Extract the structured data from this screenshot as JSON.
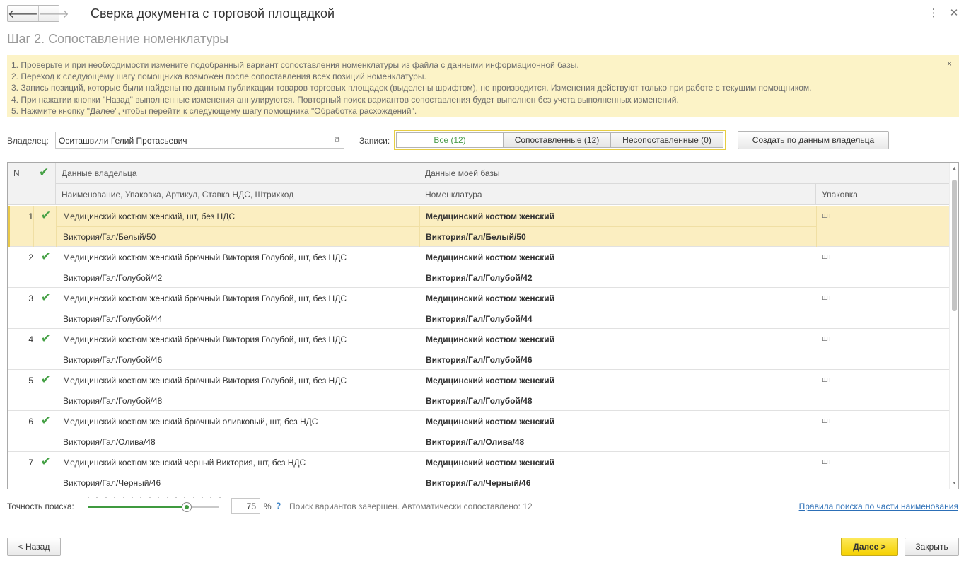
{
  "window": {
    "title": "Сверка документа с торговой площадкой",
    "back_icon": "arrow-left-icon",
    "forward_icon": "arrow-right-icon",
    "more_icon": "more-vertical-icon",
    "close_icon": "close-icon"
  },
  "step_title": "Шаг 2. Сопоставление номенклатуры",
  "info": {
    "lines": [
      "1. Проверьте и при необходимости измените подобранный вариант сопоставления номенклатуры из файла с данными информационной базы.",
      "2. Переход к следующему шагу помощника возможен после сопоставления всех позиций номенклатуры.",
      "3. Запись позиций, которые были найдены по данным публикации товаров торговых площадок (выделены шрифтом), не производится. Изменения действуют только при работе с текущим помощником.",
      "4. При нажатии кнопки \"Назад\" выполненные изменения аннулируются. Повторный поиск вариантов сопоставления будет выполнен без учета выполненных изменений.",
      "5. Нажмите кнопку \"Далее\", чтобы перейти к следующему шагу помощника \"Обработка расхождений\"."
    ],
    "close_glyph": "×"
  },
  "owner": {
    "label": "Владелец:",
    "value": "Оситашвили Гелий Протасьевич",
    "open_icon": "open-window-icon"
  },
  "records": {
    "label": "Записи:",
    "filters": [
      "Все (12)",
      "Сопоставленные (12)",
      "Несопоставленные (0)"
    ],
    "active_index": 0
  },
  "create_button": "Создать по данным владельца",
  "table": {
    "col_n": "N",
    "col_check_icon": "checkmark-icon",
    "group_owner": "Данные владельца",
    "group_base": "Данные моей базы",
    "sub_owner": "Наименование, Упаковка, Артикул, Ставка НДС, Штрихкод",
    "sub_nomenclature": "Номенклатура",
    "sub_package": "Упаковка",
    "rows": [
      {
        "n": "1",
        "owner_line1": "Медицинский костюм женский, шт, без НДС",
        "owner_line2": "Виктория/Гал/Белый/50",
        "nom_line1": "Медицинский костюм женский",
        "nom_line2": "Виктория/Гал/Белый/50",
        "unit": "шт"
      },
      {
        "n": "2",
        "owner_line1": "Медицинский костюм женский брючный Виктория Голубой, шт, без НДС",
        "owner_line2": "Виктория/Гал/Голубой/42",
        "nom_line1": "Медицинский костюм женский",
        "nom_line2": "Виктория/Гал/Голубой/42",
        "unit": "шт"
      },
      {
        "n": "3",
        "owner_line1": "Медицинский костюм женский брючный Виктория Голубой, шт, без НДС",
        "owner_line2": "Виктория/Гал/Голубой/44",
        "nom_line1": "Медицинский костюм женский",
        "nom_line2": "Виктория/Гал/Голубой/44",
        "unit": "шт"
      },
      {
        "n": "4",
        "owner_line1": "Медицинский костюм женский брючный Виктория Голубой, шт, без НДС",
        "owner_line2": "Виктория/Гал/Голубой/46",
        "nom_line1": "Медицинский костюм женский",
        "nom_line2": "Виктория/Гал/Голубой/46",
        "unit": "шт"
      },
      {
        "n": "5",
        "owner_line1": "Медицинский костюм женский брючный Виктория Голубой, шт, без НДС",
        "owner_line2": "Виктория/Гал/Голубой/48",
        "nom_line1": "Медицинский костюм женский",
        "nom_line2": "Виктория/Гал/Голубой/48",
        "unit": "шт"
      },
      {
        "n": "6",
        "owner_line1": "Медицинский костюм женский брючный оливковый, шт, без НДС",
        "owner_line2": "Виктория/Гал/Олива/48",
        "nom_line1": "Медицинский костюм женский",
        "nom_line2": "Виктория/Гал/Олива/48",
        "unit": "шт"
      },
      {
        "n": "7",
        "owner_line1": "Медицинский костюм женский черный Виктория, шт, без НДС",
        "owner_line2": "Виктория/Гал/Черный/46",
        "nom_line1": "Медицинский костюм женский",
        "nom_line2": "Виктория/Гал/Черный/46",
        "unit": "шт"
      }
    ],
    "selected_row": 0
  },
  "search": {
    "label": "Точность поиска:",
    "accuracy_value": "75",
    "accuracy_fraction": 0.75,
    "percent_sign": "%",
    "help_glyph": "?",
    "status": "Поиск вариантов завершен. Автоматически сопоставлено: 12",
    "rules_link": "Правила поиска по части наименования"
  },
  "footer": {
    "back_button": "< Назад",
    "next_button": "Далее >",
    "close_button": "Закрыть"
  },
  "colors": {
    "accent_green": "#46a146",
    "info_bg": "#fcf3c7",
    "selected_row": "#fbeec1",
    "next_button": "#f5d100",
    "link": "#2c6fb7"
  }
}
